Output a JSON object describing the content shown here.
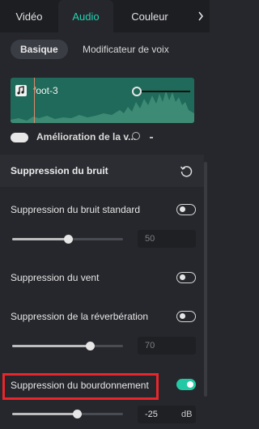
{
  "tabs": {
    "video": "Vidéo",
    "audio": "Audio",
    "couleur": "Couleur"
  },
  "subtabs": {
    "basique": "Basique",
    "modificateur": "Modificateur de voix"
  },
  "clip": {
    "name": "foot-3"
  },
  "hidden_row": {
    "label": "Amélioration de la v..."
  },
  "section": {
    "title": "Suppression du bruit"
  },
  "rows": [
    {
      "label": "Suppression du bruit standard",
      "enabled": false,
      "slider_value": 50,
      "value_text": "50"
    },
    {
      "label": "Suppression du vent",
      "enabled": false
    },
    {
      "label": "Suppression de la réverbération",
      "enabled": false,
      "slider_value": 70,
      "value_text": "70"
    },
    {
      "label": "Suppression du bourdonnement",
      "enabled": true,
      "slider_value": -25,
      "value_text": "-25",
      "unit": "dB"
    }
  ],
  "colors": {
    "accent": "#22c9a4",
    "highlight": "#e8262b",
    "waveform_bg": "#1f6a5a"
  }
}
